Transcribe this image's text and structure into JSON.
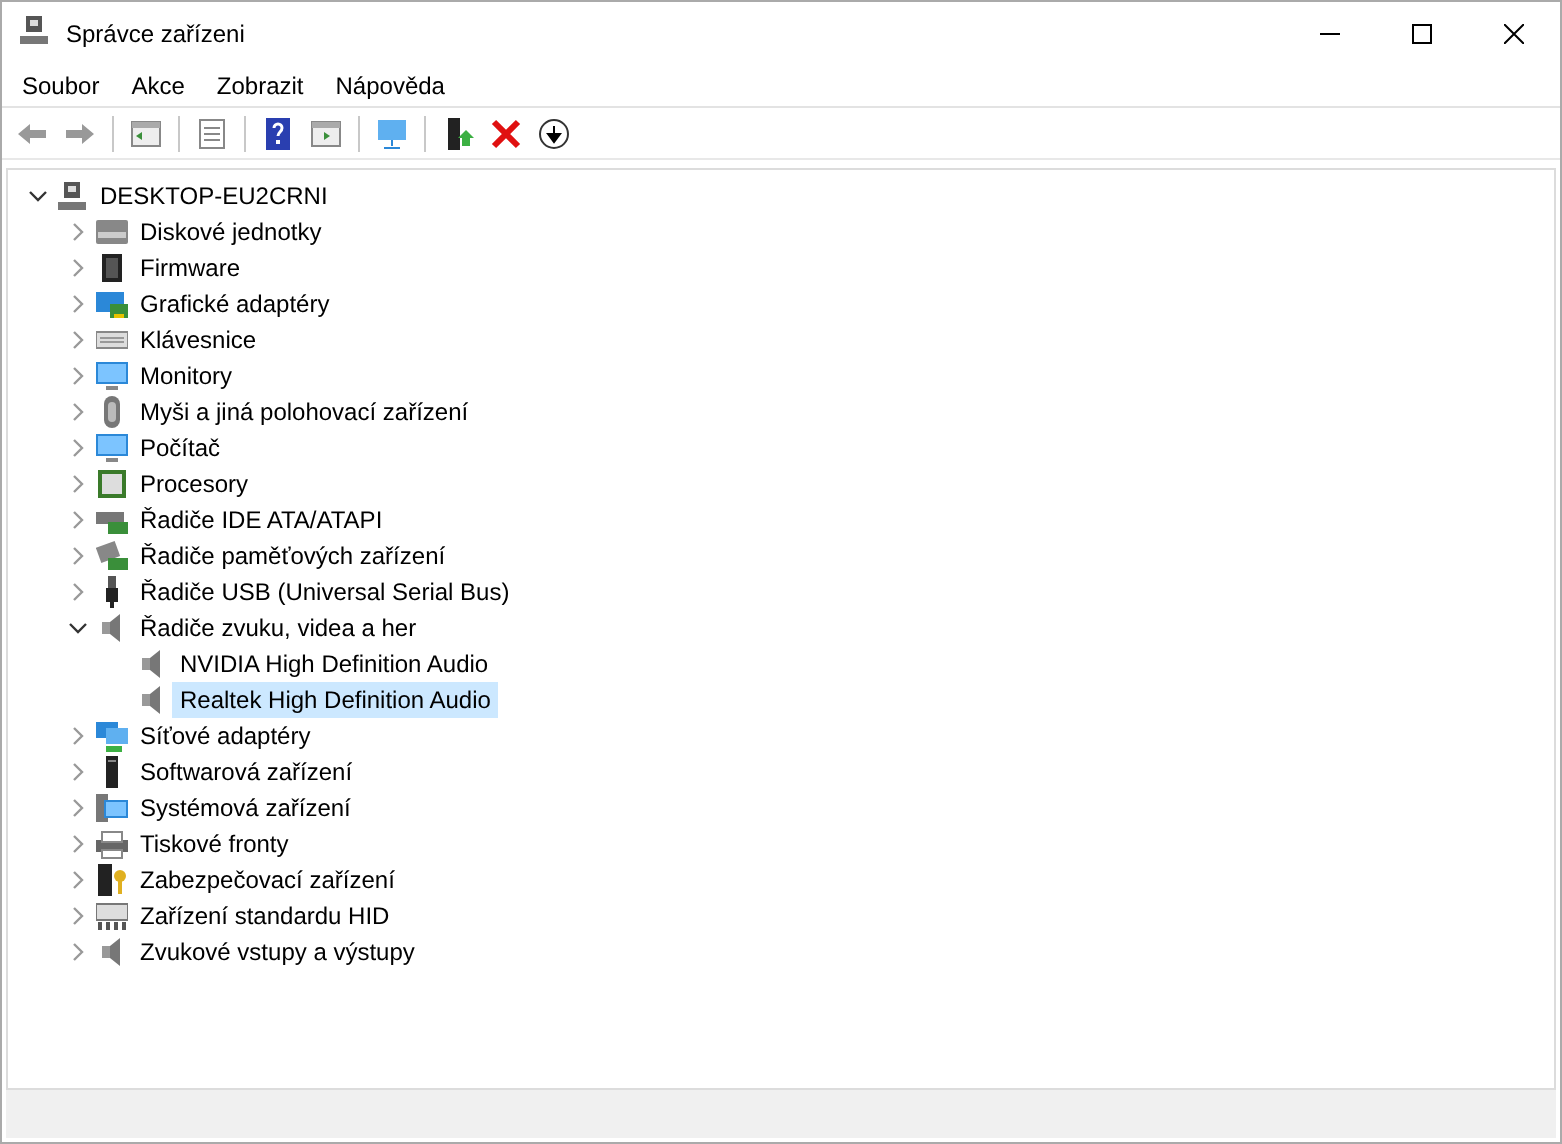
{
  "window": {
    "title": "Správce zařízeni"
  },
  "menu": [
    "Soubor",
    "Akce",
    "Zobrazit",
    "Nápověda"
  ],
  "tree": {
    "label": "DESKTOP-EU2CRNI",
    "expanded": true,
    "selected": false,
    "children": [
      {
        "label": "Diskové jednotky",
        "expanded": false,
        "selected": false
      },
      {
        "label": "Firmware",
        "expanded": false,
        "selected": false
      },
      {
        "label": "Grafické adaptéry",
        "expanded": false,
        "selected": false
      },
      {
        "label": "Klávesnice",
        "expanded": false,
        "selected": false
      },
      {
        "label": "Monitory",
        "expanded": false,
        "selected": false
      },
      {
        "label": "Myši a jiná polohovací zařízení",
        "expanded": false,
        "selected": false
      },
      {
        "label": "Počítač",
        "expanded": false,
        "selected": false
      },
      {
        "label": "Procesory",
        "expanded": false,
        "selected": false
      },
      {
        "label": "Řadiče IDE ATA/ATAPI",
        "expanded": false,
        "selected": false
      },
      {
        "label": "Řadiče paměťových zařízení",
        "expanded": false,
        "selected": false
      },
      {
        "label": "Řadiče USB (Universal Serial Bus)",
        "expanded": false,
        "selected": false
      },
      {
        "label": "Řadiče zvuku, videa a her",
        "expanded": true,
        "selected": false,
        "children": [
          {
            "label": "NVIDIA High Definition Audio",
            "selected": false
          },
          {
            "label": "Realtek High Definition Audio",
            "selected": true
          }
        ]
      },
      {
        "label": "Síťové adaptéry",
        "expanded": false,
        "selected": false
      },
      {
        "label": "Softwarová zařízení",
        "expanded": false,
        "selected": false
      },
      {
        "label": "Systémová zařízení",
        "expanded": false,
        "selected": false
      },
      {
        "label": "Tiskové fronty",
        "expanded": false,
        "selected": false
      },
      {
        "label": "Zabezpečovací zařízení",
        "expanded": false,
        "selected": false
      },
      {
        "label": "Zařízení standardu HID",
        "expanded": false,
        "selected": false
      },
      {
        "label": "Zvukové vstupy a výstupy",
        "expanded": false,
        "selected": false
      }
    ]
  }
}
